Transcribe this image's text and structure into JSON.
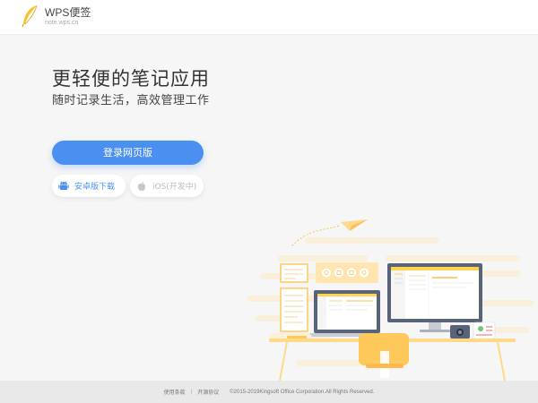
{
  "header": {
    "logo_title": "WPS便签",
    "logo_domain": "note.wps.cn"
  },
  "hero": {
    "headline": "更轻便的笔记应用",
    "subline": "随时记录生活，高效管理工作"
  },
  "actions": {
    "login_label": "登录网页版",
    "android_label": "安卓版下载",
    "ios_label": "iOS(开发中)"
  },
  "footer": {
    "terms": "使用条款",
    "separator": "|",
    "license": "开源协议",
    "copyright": "©2015-2019Kingsoft Office Corporation.All Rights Reserved."
  },
  "colors": {
    "primary": "#4a90f0",
    "logo_yellow": "#f5c330",
    "illustration_orange": "#ffc85a"
  }
}
